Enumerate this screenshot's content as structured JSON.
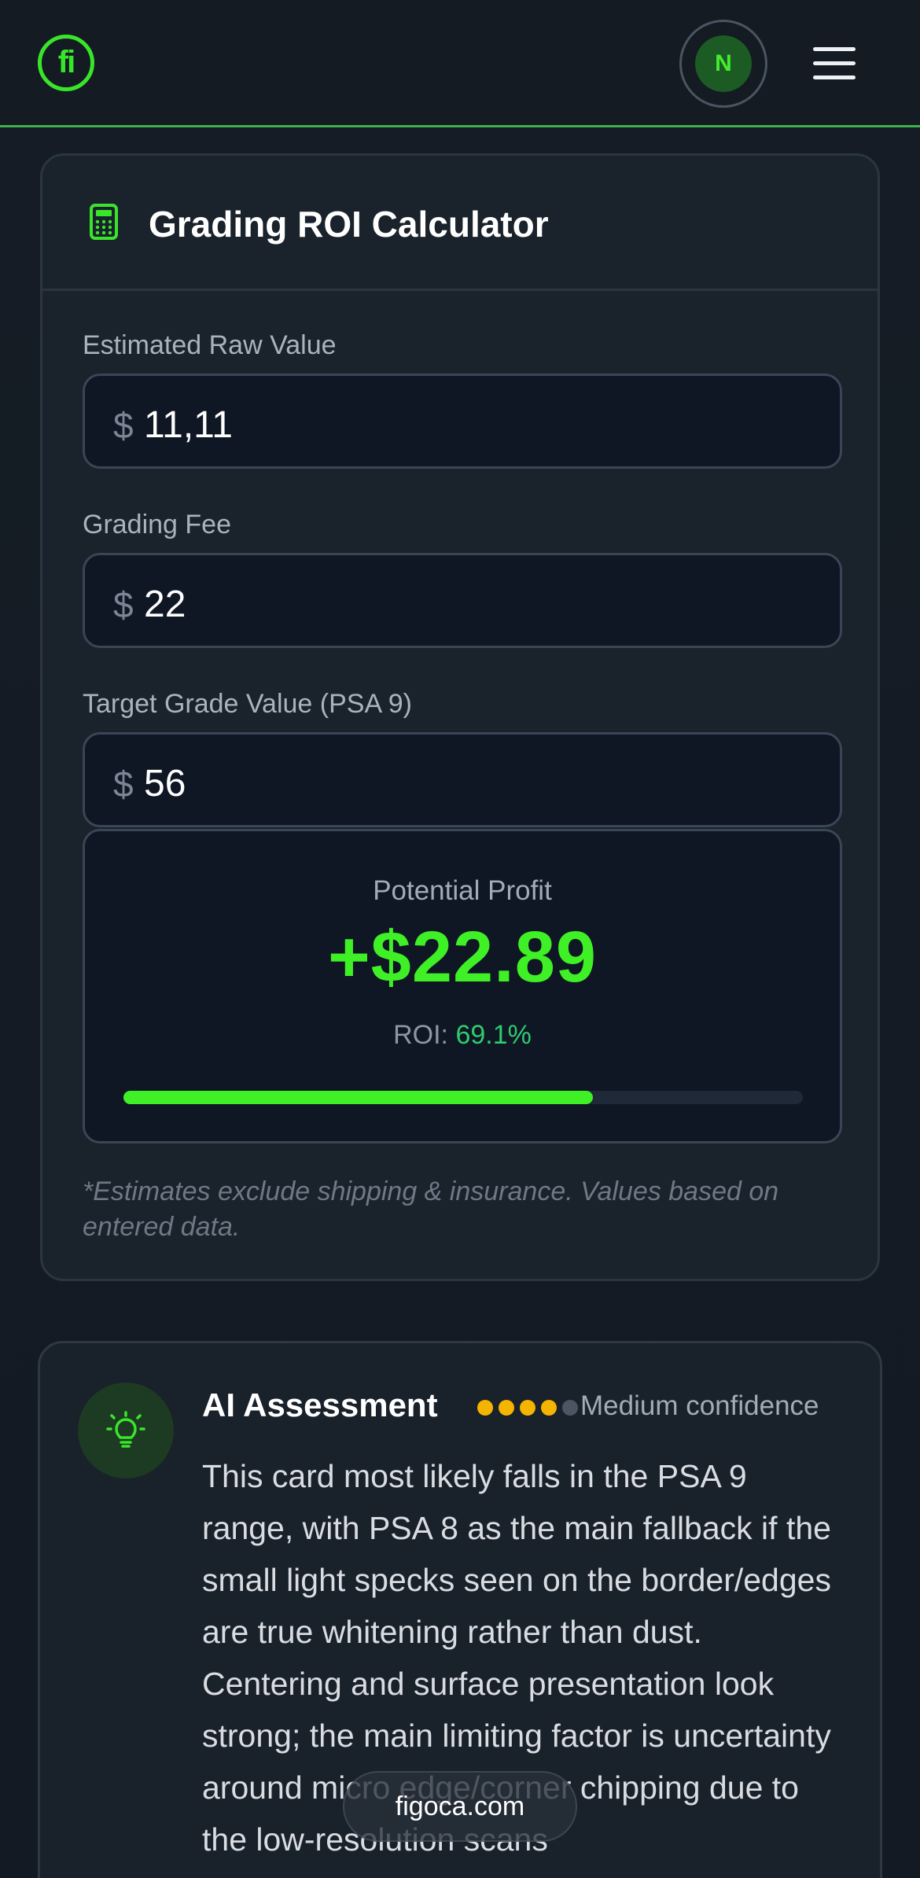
{
  "header": {
    "logo_text": "fi",
    "avatar_initial": "N",
    "accent_color": "#39e52a"
  },
  "calculator": {
    "title": "Grading ROI Calculator",
    "icon": "calculator-icon",
    "fields": [
      {
        "label": "Estimated Raw Value",
        "currency": "$",
        "value": "11,11"
      },
      {
        "label": "Grading Fee",
        "currency": "$",
        "value": "22"
      },
      {
        "label": "Target Grade Value (PSA 9)",
        "currency": "$",
        "value": "56"
      }
    ],
    "result": {
      "label": "Potential Profit",
      "value": "+$22.89",
      "roi_label": "ROI:",
      "roi_value": "69.1%",
      "progress_fraction": 0.691
    },
    "note": "*Estimates exclude shipping & insurance. Values based on entered data."
  },
  "assessment": {
    "icon": "lightbulb-icon",
    "title": "AI Assessment",
    "confidence_dots_filled": 4,
    "confidence_dots_total": 5,
    "confidence_label": "Medium confidence",
    "body": "This card most likely falls in the PSA 9 range, with PSA 8 as the main fallback if the small light specks seen on the border/edges are true whitening rather than dust. Centering and surface presentation look strong; the main limiting factor is uncertainty around micro edge/corner chipping due to the low-resolution scans"
  },
  "watermark": {
    "text": "figoca.com"
  },
  "colors": {
    "accent": "#3ef025",
    "roi": "#2ecc6f",
    "confidence_filled": "#f5b400",
    "confidence_empty": "#4b5563"
  }
}
